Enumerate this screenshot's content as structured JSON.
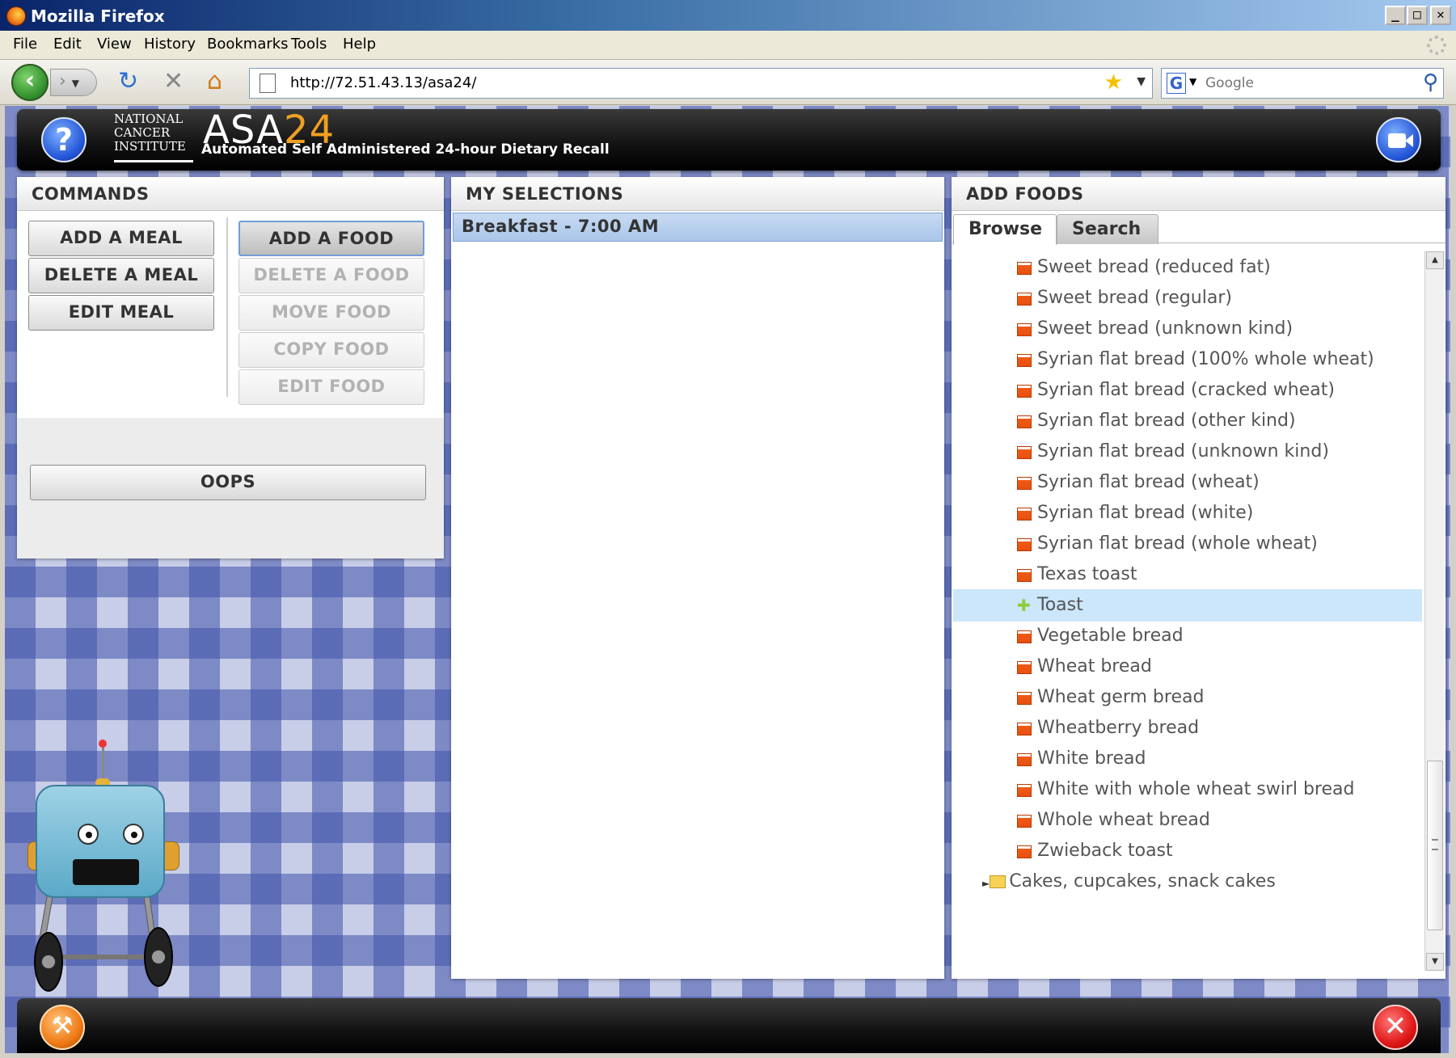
{
  "window": {
    "title": "Mozilla Firefox",
    "minimize": "_",
    "maximize": "□",
    "close": "✕"
  },
  "menu": [
    "File",
    "Edit",
    "View",
    "History",
    "Bookmarks",
    "Tools",
    "Help"
  ],
  "navigation": {
    "url": "http://72.51.43.13/asa24/",
    "search_placeholder": "Google",
    "icons": [
      "back-icon",
      "forward-icon",
      "reload-icon",
      "stop-icon",
      "home-icon",
      "page-icon",
      "bookmark-star-icon",
      "google-icon",
      "magnifier-icon"
    ]
  },
  "header": {
    "nci_logo": "NATIONAL CANCER INSTITUTE",
    "nci_line1": "NATIONAL",
    "nci_line2": "CANCER",
    "nci_line3": "INSTITUTE",
    "app_name_a": "ASA",
    "app_name_b": "24",
    "subtitle": "Automated Self Administered 24-hour Dietary Recall",
    "help_glyph": "?"
  },
  "commands": {
    "title": "COMMANDS",
    "left_buttons": [
      "ADD A MEAL",
      "DELETE A MEAL",
      "EDIT MEAL"
    ],
    "right_buttons": [
      "ADD A FOOD",
      "DELETE A FOOD",
      "MOVE FOOD",
      "COPY FOOD",
      "EDIT FOOD"
    ],
    "oops": "OOPS"
  },
  "selections": {
    "title": "MY SELECTIONS",
    "meals": [
      "Breakfast - 7:00 AM"
    ]
  },
  "add_foods": {
    "title": "ADD FOODS",
    "tabs": [
      "Browse",
      "Search"
    ],
    "active_tab": "Browse",
    "items": [
      "Sweet bread (reduced fat)",
      "Sweet bread (regular)",
      "Sweet bread (unknown kind)",
      "Syrian flat bread (100% whole wheat)",
      "Syrian flat bread (cracked wheat)",
      "Syrian flat bread (other kind)",
      "Syrian flat bread (unknown kind)",
      "Syrian flat bread (wheat)",
      "Syrian flat bread (white)",
      "Syrian flat bread (whole wheat)",
      "Texas toast",
      "Toast",
      "Vegetable bread",
      "Wheat bread",
      "Wheat germ bread",
      "Wheatberry bread",
      "White bread",
      "White with whole wheat swirl bread",
      "Whole wheat bread",
      "Zwieback toast"
    ],
    "selected_item": "Toast",
    "next_category": "Cakes, cupcakes, snack cakes"
  },
  "footer": {
    "tools_glyph": "⚒",
    "close_glyph": "✕"
  },
  "colors": {
    "accent_blue": "#2456d8",
    "selected_row": "#cce6fb",
    "meal_row": "#a9c6ea",
    "leaf_icon": "#f05a14"
  }
}
